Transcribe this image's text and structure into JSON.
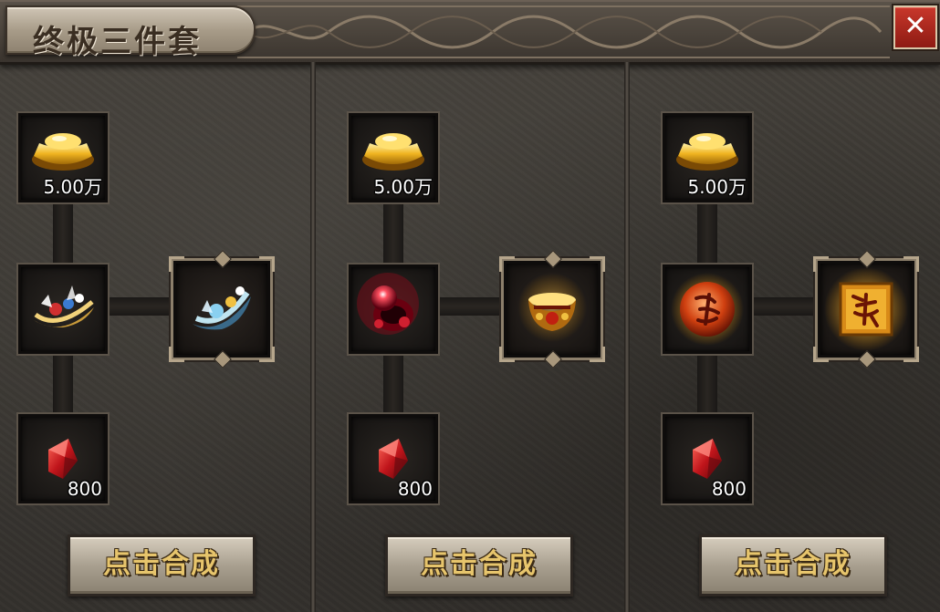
{
  "window": {
    "title": "终极三件套",
    "close_label": "✕"
  },
  "colors": {
    "button_text": "#e7c56c",
    "close_bg": "#c8372b",
    "gold": "#f0b420",
    "red_gem": "#c0151b"
  },
  "recipes": [
    {
      "inputs": [
        {
          "icon": "gold-ingot-icon",
          "qty": "5.00万"
        },
        {
          "icon": "jeweled-necklace-icon",
          "qty": ""
        },
        {
          "icon": "red-gem-icon",
          "qty": "800"
        }
      ],
      "result": {
        "icon": "blue-jeweled-necklace-icon"
      },
      "button_label": "点击合成"
    },
    {
      "inputs": [
        {
          "icon": "gold-ingot-icon",
          "qty": "5.00万"
        },
        {
          "icon": "red-glowing-bracelet-icon",
          "qty": ""
        },
        {
          "icon": "red-gem-icon",
          "qty": "800"
        }
      ],
      "result": {
        "icon": "golden-ornate-bracelet-icon"
      },
      "button_label": "点击合成"
    },
    {
      "inputs": [
        {
          "icon": "gold-ingot-icon",
          "qty": "5.00万"
        },
        {
          "icon": "soul-orb-icon",
          "qty": ""
        },
        {
          "icon": "red-gem-icon",
          "qty": "800"
        }
      ],
      "result": {
        "icon": "fire-rune-tablet-icon"
      },
      "button_label": "点击合成"
    }
  ]
}
